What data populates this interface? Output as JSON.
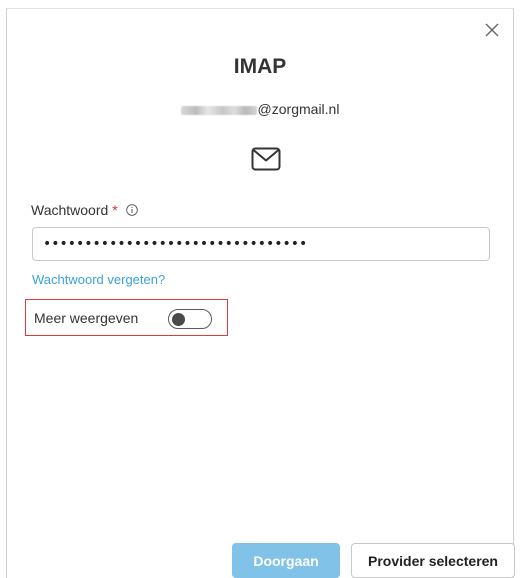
{
  "dialog": {
    "title": "IMAP",
    "email_domain": "@zorgmail.nl",
    "close_icon": "close-icon",
    "mail_icon": "envelope-icon"
  },
  "password": {
    "label": "Wachtwoord",
    "required_marker": "*",
    "info_icon": "info-icon",
    "value": "••••••••••••••••••••••••••••••••"
  },
  "forgot_link": "Wachtwoord vergeten?",
  "show_more": {
    "label": "Meer weergeven",
    "toggle_on": false
  },
  "buttons": {
    "continue": "Doorgaan",
    "select_provider": "Provider selecteren"
  },
  "colors": {
    "accent": "#3aa3d9",
    "primary_button": "#80c2e8",
    "highlight_border": "#e03a3a",
    "required": "#d13438"
  }
}
